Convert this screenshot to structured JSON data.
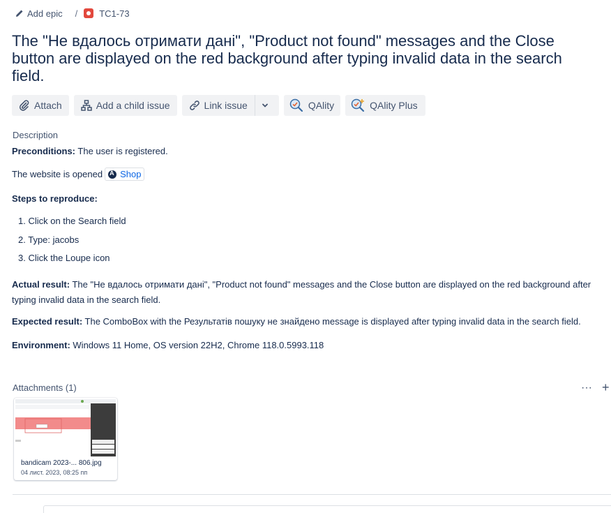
{
  "breadcrumb": {
    "add_epic": "Add epic",
    "separator": "/",
    "issue_key": "TC1-73",
    "issue_type_color": "#e2483d"
  },
  "issue": {
    "title": "The \"Не вдалось отримати дані\", \"Product not found\" messages and the Close button are displayed on the red background after typing invalid data in the search field."
  },
  "toolbar": {
    "attach": "Attach",
    "add_child": "Add a child issue",
    "link_issue": "Link issue",
    "qality": "QAlity",
    "qality_plus": "QAlity Plus"
  },
  "description": {
    "label": "Description",
    "preconditions_label": "Preconditions:",
    "preconditions_text": " The user is registered.",
    "website_text": "The website is opened",
    "shop_link": "Shop",
    "steps_label": "Steps to reproduce:",
    "steps": [
      "1. Click on the Search field",
      "2. Type: jacobs",
      "3. Click the Loupe icon"
    ],
    "actual_label": "Actual result:",
    "actual_text": " The \"Не вдалось отримати дані\", \"Product not found\" messages and the Close button are displayed on the red background after typing invalid data in the search field.",
    "expected_label": "Expected result:",
    "expected_text": " The ComboBox with the Результатів пошуку не знайдено message is displayed after typing invalid data in the search field.",
    "environment_label": "Environment:",
    "environment_text": " Windows 11 Home, OS version 22H2, Chrome 118.0.5993.118"
  },
  "attachments": {
    "label": "Attachments (1)",
    "more_icon": "···",
    "add_icon": "+",
    "items": [
      {
        "name": "bandicam 2023-... 806.jpg",
        "date": "04 лист. 2023, 08:25 пп"
      }
    ]
  },
  "colors": {
    "link": "#0c66e4",
    "text": "#172b4d",
    "button_bg": "#f1f2f4"
  }
}
